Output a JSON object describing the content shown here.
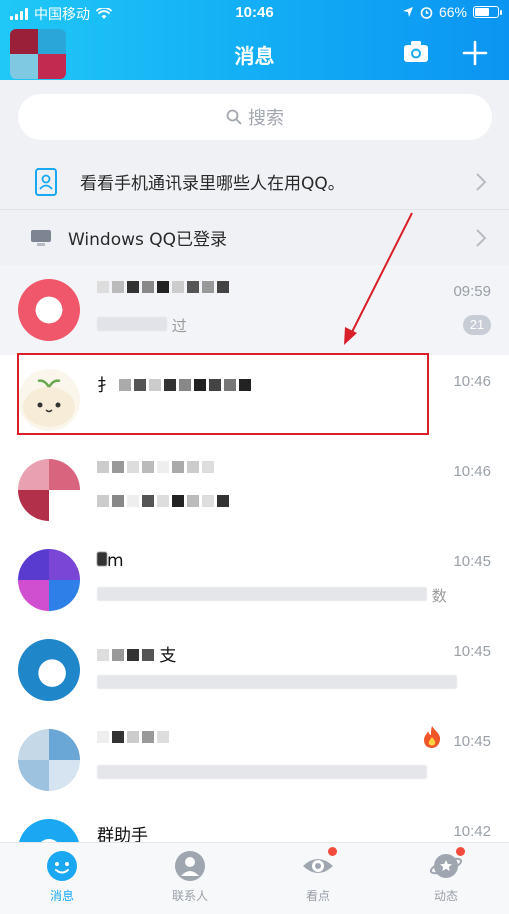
{
  "status_bar": {
    "carrier": "中国移动",
    "time": "10:46",
    "battery_pct": "66%",
    "battery_level": 0.66
  },
  "header": {
    "title": "消息",
    "camera_icon": "camera-icon",
    "plus_icon": "plus-icon"
  },
  "search": {
    "placeholder": "搜索",
    "icon": "search-icon"
  },
  "banners": [
    {
      "label": "看看手机通讯录里哪些人在用QQ。",
      "icon": "contacts-book-icon"
    },
    {
      "label": "Windows QQ已登录",
      "icon": "desktop-computer-icon"
    }
  ],
  "conversations": [
    {
      "time": "09:59",
      "preview": "过",
      "badge": "21",
      "avatar_color": "#f0576a"
    },
    {
      "time": "10:46",
      "name": "扌",
      "avatar_color": "#f1e6cf",
      "highlighted": true
    },
    {
      "time": "10:46",
      "avatar_color": "#d9647e"
    },
    {
      "time": "10:45",
      "name": "m",
      "preview": "数",
      "avatar_color": "#7a46d6"
    },
    {
      "time": "10:45",
      "name": "支",
      "avatar_color": "#1e86c9"
    },
    {
      "time": "10:45",
      "avatar_color": "#6aa6d6",
      "fire_icon": "fire-icon"
    },
    {
      "time": "10:42",
      "name": "群助手",
      "avatar_color": "#1aa8f3"
    }
  ],
  "tabs": [
    {
      "label": "消息",
      "icon": "message-bubble-icon",
      "active": true
    },
    {
      "label": "联系人",
      "icon": "contact-person-icon",
      "active": false
    },
    {
      "label": "看点",
      "icon": "eye-icon",
      "active": false,
      "dot": true
    },
    {
      "label": "动态",
      "icon": "planet-star-icon",
      "active": false,
      "dot": true
    }
  ],
  "colors": {
    "header_gradient_start": "#1fc8f6",
    "header_gradient_end": "#0b95f2",
    "accent": "#1aa8f3",
    "annotation_red": "#d9202a"
  }
}
